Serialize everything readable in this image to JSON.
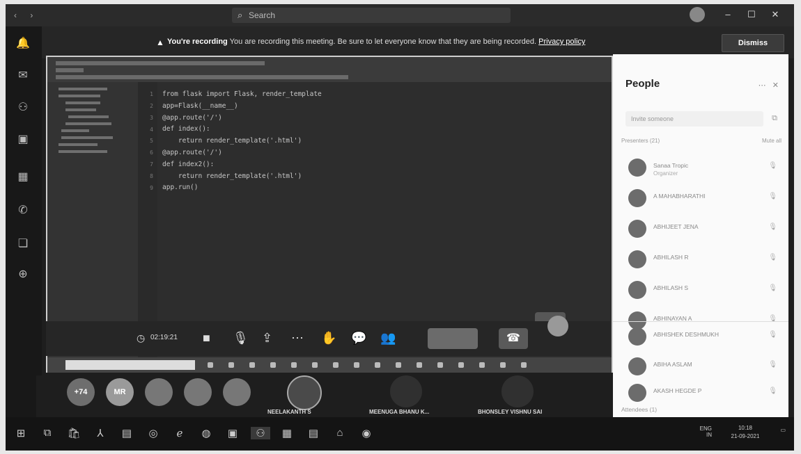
{
  "search": {
    "placeholder": "Search"
  },
  "banner": {
    "title": "You're recording",
    "message": "You are recording this meeting. Be sure to let everyone know that they are being recorded.",
    "link": "Privacy policy",
    "dismiss_label": "Dismiss"
  },
  "code_lines": [
    "from flask import Flask, render_template",
    "app=Flask(__name__)",
    "@app.route('/')",
    "def index():",
    "    return render_template('.html')",
    "@app.route('/')",
    "def index2():",
    "    return render_template('.html')",
    "app.run()"
  ],
  "controls": {
    "timer": "02:19:21"
  },
  "gallery": {
    "overflow_count": "+74",
    "initials": "MR",
    "names": [
      "NEELAKANTH S",
      "MEENUGA BHANU K...",
      "BHONSLEY VISHNU SAI"
    ]
  },
  "people": {
    "title": "People",
    "invite_placeholder": "Invite someone",
    "presenters_label": "Presenters (21)",
    "mute_all": "Mute all",
    "attendees_label": "Attendees (1)",
    "list": [
      {
        "name": "Sanaa Tropic",
        "role": "Organizer"
      },
      {
        "name": "A MAHABHARATHI",
        "role": ""
      },
      {
        "name": "ABHIJEET JENA",
        "role": ""
      },
      {
        "name": "ABHILASH R",
        "role": ""
      },
      {
        "name": "ABHILASH S",
        "role": ""
      },
      {
        "name": "ABHINAYAN A",
        "role": ""
      },
      {
        "name": "ABHISHEK DESHMUKH",
        "role": ""
      },
      {
        "name": "ABIHA ASLAM",
        "role": ""
      },
      {
        "name": "AKASH HEGDE P",
        "role": ""
      }
    ]
  },
  "tray": {
    "language": "ENG IN",
    "time": "10:18",
    "date": "21-09-2021"
  },
  "colors": {
    "panel_bg": "#fafafa",
    "app_bg": "#1e1e1e",
    "banner_bg": "#262626"
  },
  "icons": [
    "search-icon",
    "mic-icon",
    "camera-icon",
    "share-icon",
    "more-icon",
    "raise-hand-icon",
    "chat-icon",
    "people-icon",
    "hang-up-icon"
  ]
}
